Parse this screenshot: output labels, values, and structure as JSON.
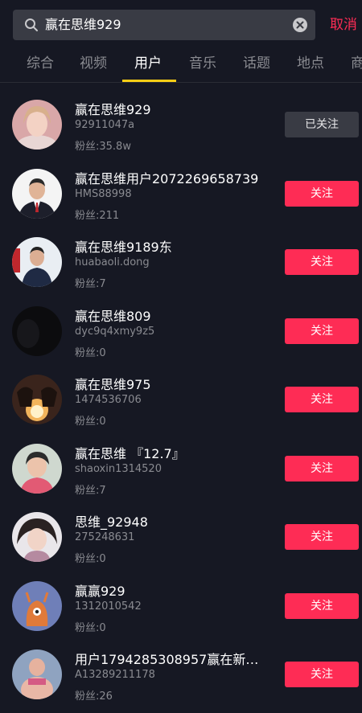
{
  "search": {
    "query": "赢在思维929",
    "cancel_label": "取消"
  },
  "tabs": [
    {
      "label": "综合"
    },
    {
      "label": "视频"
    },
    {
      "label": "用户"
    },
    {
      "label": "音乐"
    },
    {
      "label": "话题"
    },
    {
      "label": "地点"
    },
    {
      "label": "商"
    }
  ],
  "active_tab": "用户",
  "colors": {
    "background": "#161823",
    "accent": "#fe2c55",
    "tab_indicator": "#face15",
    "secondary_text": "#8a8b91"
  },
  "users": [
    {
      "name": "赢在思维929",
      "id": "92911047a",
      "fans": "粉丝:35.8w",
      "button": "已关注",
      "followed": true
    },
    {
      "name": "赢在思维用户2072269658739",
      "id": "HMS88998",
      "fans": "粉丝:211",
      "button": "关注",
      "followed": false
    },
    {
      "name": "赢在思维9189东",
      "id": "huabaoli.dong",
      "fans": "粉丝:7",
      "button": "关注",
      "followed": false
    },
    {
      "name": "赢在思维809",
      "id": "dyc9q4xmy9z5",
      "fans": "粉丝:0",
      "button": "关注",
      "followed": false
    },
    {
      "name": "赢在思维975",
      "id": "1474536706",
      "fans": "粉丝:0",
      "button": "关注",
      "followed": false
    },
    {
      "name": "赢在思维 『12.7』",
      "id": "shaoxin1314520",
      "fans": "粉丝:7",
      "button": "关注",
      "followed": false
    },
    {
      "name": "思维_92948",
      "id": "275248631",
      "fans": "粉丝:0",
      "button": "关注",
      "followed": false
    },
    {
      "name": "赢赢929",
      "id": "1312010542",
      "fans": "粉丝:0",
      "button": "关注",
      "followed": false
    },
    {
      "name": "用户1794285308957赢在新…",
      "id": "A13289211178",
      "fans": "粉丝:26",
      "button": "关注",
      "followed": false
    }
  ]
}
